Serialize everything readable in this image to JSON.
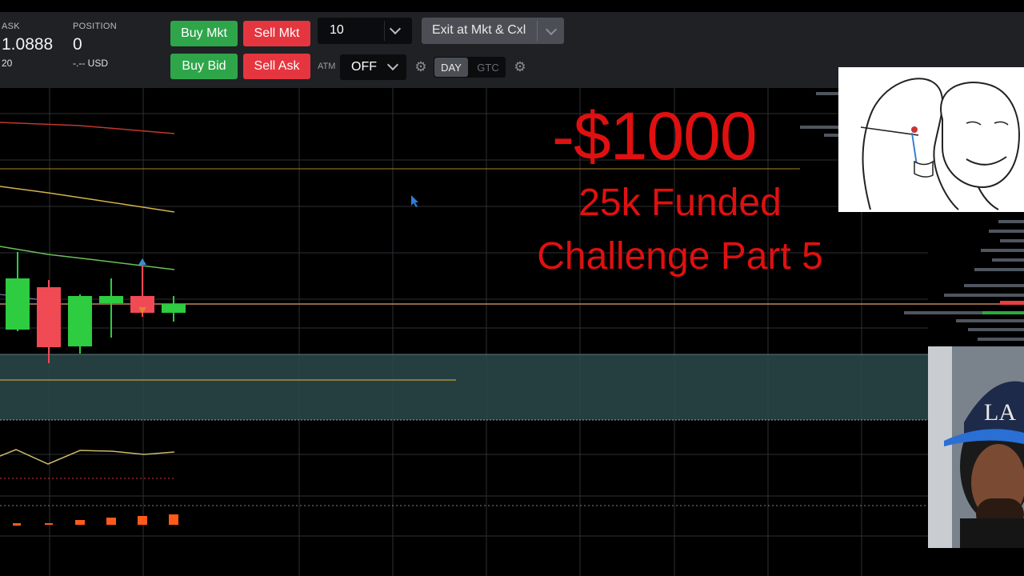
{
  "header": {
    "ask_label": "ASK",
    "ask_value": "1.0888",
    "ask_sub": "20",
    "position_label": "POSITION",
    "position_value": "0",
    "position_sub": "-.-- USD"
  },
  "order_buttons": {
    "buy_mkt": "Buy Mkt",
    "sell_mkt": "Sell Mkt",
    "buy_bid": "Buy Bid",
    "sell_ask": "Sell Ask"
  },
  "quantity": {
    "value": "10"
  },
  "exit_button": {
    "label": "Exit at Mkt & Cxl"
  },
  "atm": {
    "label": "ATM",
    "value": "OFF"
  },
  "time_in_force": {
    "options": [
      "DAY",
      "GTC"
    ],
    "selected": "DAY"
  },
  "overlay": {
    "title": "-$1000",
    "subtitle_line1": "25k Funded",
    "subtitle_line2": "Challenge Part 5"
  },
  "colors": {
    "toolbar_bg": "#1f2124",
    "buy": "#2fa54a",
    "sell": "#e5363f",
    "overlay_text": "#e01010",
    "band": "#2b4a4c"
  },
  "icons": [
    "chevron-down-icon",
    "gear-icon",
    "cursor-icon"
  ]
}
